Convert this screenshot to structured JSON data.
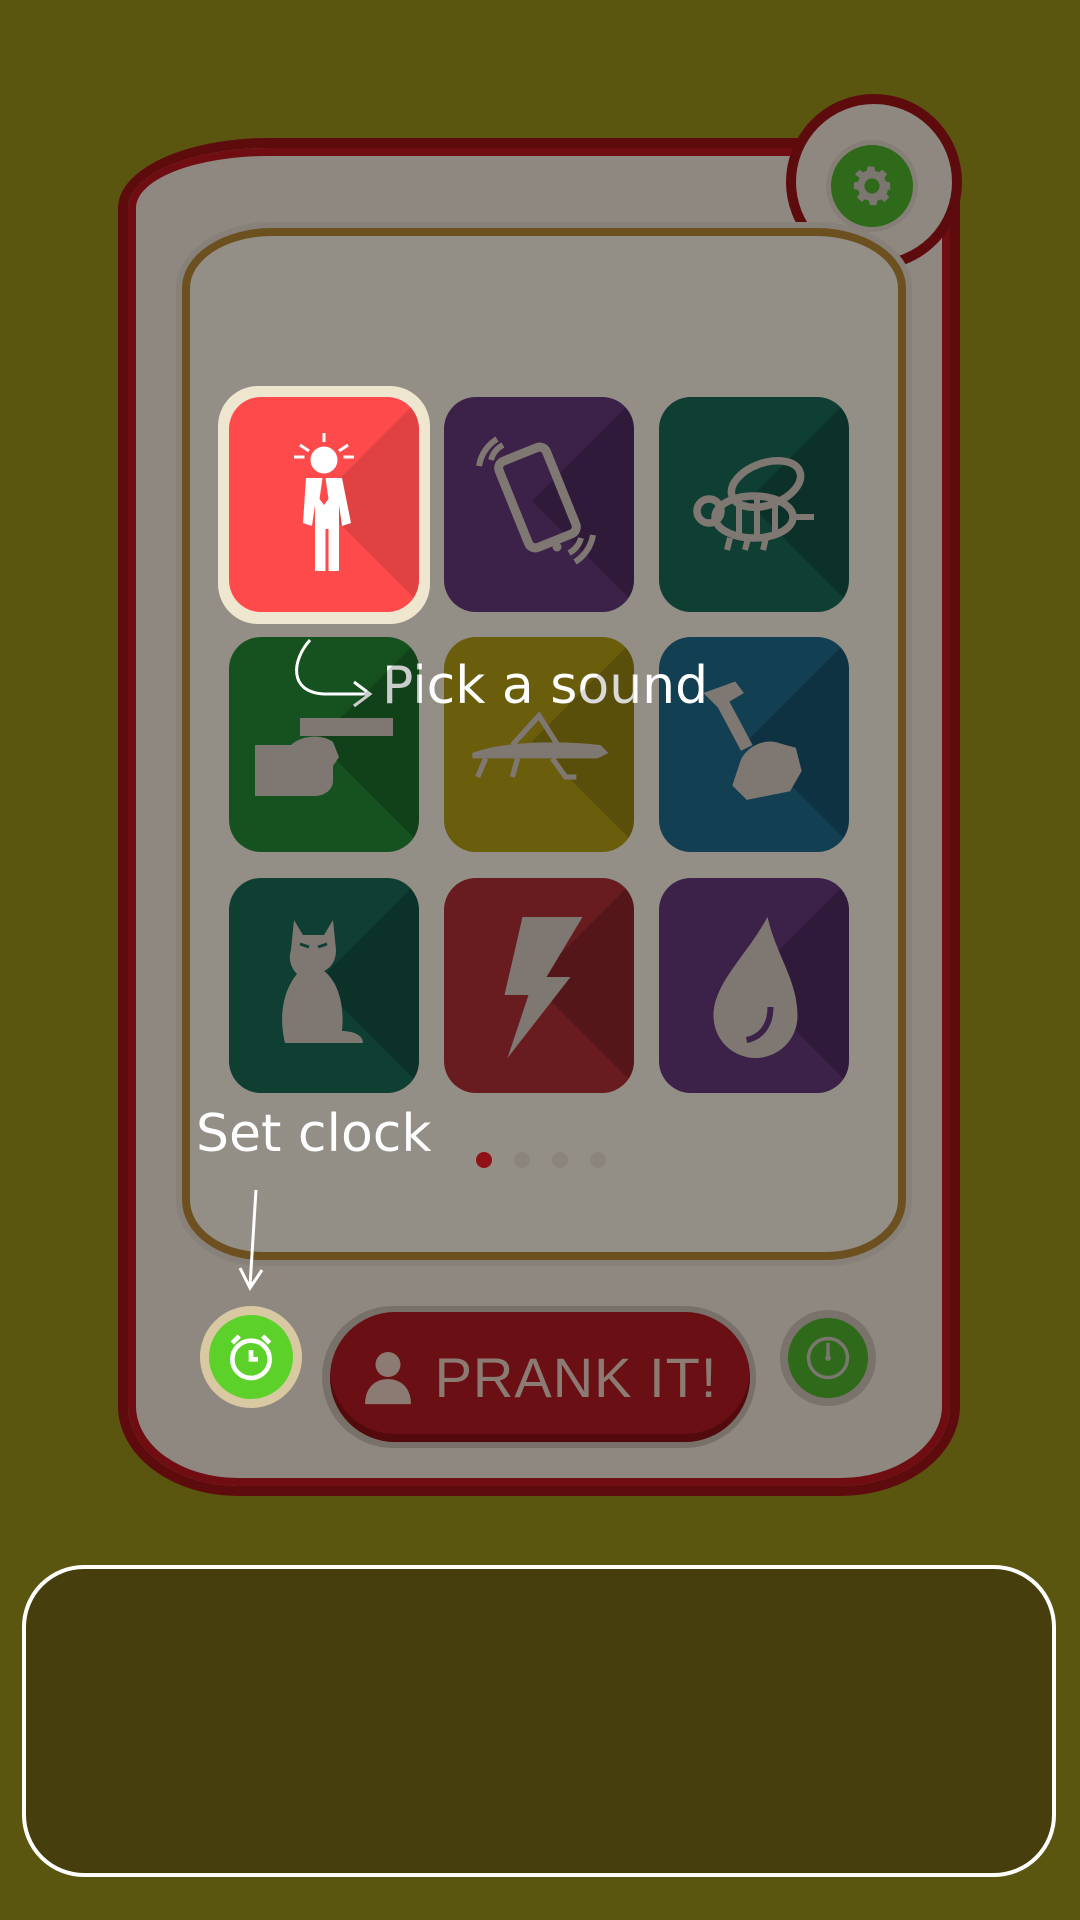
{
  "hints": {
    "pick_sound": "Pick a sound",
    "set_clock": "Set clock"
  },
  "prank_button": {
    "label": "PRANK IT!"
  },
  "sounds": [
    {
      "icon": "businessman-icon",
      "color": "#ff4a4c",
      "selected": true
    },
    {
      "icon": "vibrating-phone-icon",
      "color": "#3c2148",
      "selected": false
    },
    {
      "icon": "bee-icon",
      "color": "#0f3e33",
      "selected": false
    },
    {
      "icon": "hand-gun-icon",
      "color": "#165220",
      "selected": false
    },
    {
      "icon": "grasshopper-icon",
      "color": "#6a5d0c",
      "selected": false
    },
    {
      "icon": "hammer-hand-icon",
      "color": "#123f52",
      "selected": false
    },
    {
      "icon": "cat-icon",
      "color": "#0f3e33",
      "selected": false
    },
    {
      "icon": "lightning-icon",
      "color": "#691c1f",
      "selected": false
    },
    {
      "icon": "water-drop-icon",
      "color": "#3c2148",
      "selected": false
    }
  ],
  "pager": {
    "pages": 4,
    "current": 1,
    "active_color": "#8f1117",
    "inactive_color": "#8b857d"
  },
  "colors": {
    "background": "#5a550f",
    "phone_border": "#5e0b0e",
    "clock_button": "#5bd12a",
    "settings_button": "#2f6a1a"
  }
}
